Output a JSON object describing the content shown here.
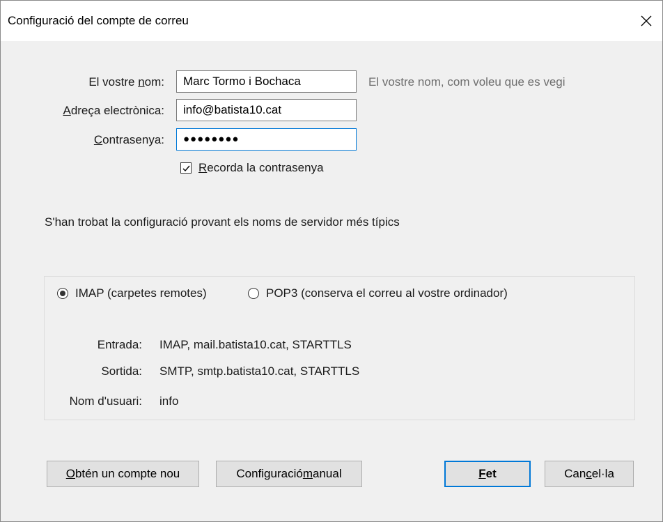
{
  "window": {
    "title": "Configuració del compte de correu"
  },
  "form": {
    "name_label_pre": "El vostre ",
    "name_label_ul": "n",
    "name_label_post": "om:",
    "name_value": "Marc Tormo i Bochaca",
    "name_hint": "El vostre nom, com voleu que es vegi",
    "email_label_ul": "A",
    "email_label_post": "dreça electrònica:",
    "email_value": "info@batista10.cat",
    "password_label_ul": "C",
    "password_label_post": "ontrasenya:",
    "password_dots": "●●●●●●●●",
    "remember_ul": "R",
    "remember_post": "ecorda la contrasenya",
    "remember_checked": true
  },
  "status": {
    "message": "S'han trobat la configuració provant els noms de servidor més típics"
  },
  "config": {
    "imap_label": "IMAP (carpetes remotes)",
    "pop3_label": "POP3 (conserva el correu al vostre ordinador)",
    "selected": "imap",
    "incoming_label": "Entrada:",
    "incoming_value": "IMAP, mail.batista10.cat, STARTTLS",
    "outgoing_label": "Sortida:",
    "outgoing_value": "SMTP, smtp.batista10.cat, STARTTLS",
    "username_label": "Nom d'usuari:",
    "username_value": "info"
  },
  "buttons": {
    "new_account_ul": "O",
    "new_account_post": "btén un compte nou",
    "manual_pre": "Configuració ",
    "manual_ul": "m",
    "manual_post": "anual",
    "done_ul": "F",
    "done_post": "et",
    "cancel_pre": "Can",
    "cancel_ul": "c",
    "cancel_post": "el·la"
  }
}
